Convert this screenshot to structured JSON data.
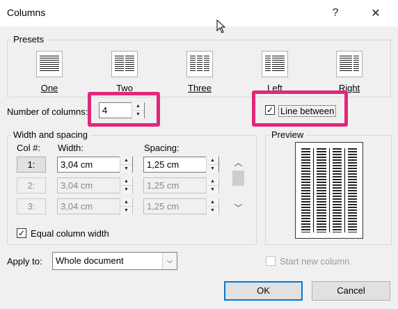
{
  "dialog": {
    "title": "Columns",
    "help_glyph": "?",
    "close_glyph": "✕"
  },
  "presets": {
    "label": "Presets",
    "items": [
      {
        "label": "One",
        "columns": 1
      },
      {
        "label": "Two",
        "columns": 2
      },
      {
        "label": "Three",
        "columns": 3
      },
      {
        "label": "Left",
        "columns": 2
      },
      {
        "label": "Right",
        "columns": 2
      }
    ]
  },
  "number_of_columns": {
    "label": "Number of columns:",
    "value": "4"
  },
  "line_between": {
    "label": "Line between",
    "checked": true
  },
  "width_spacing": {
    "label": "Width and spacing",
    "col_header": "Col #:",
    "width_header": "Width:",
    "spacing_header": "Spacing:",
    "rows": [
      {
        "col": "1:",
        "width": "3,04 cm",
        "spacing": "1,25 cm",
        "enabled": true
      },
      {
        "col": "2:",
        "width": "3,04 cm",
        "spacing": "1,25 cm",
        "enabled": false
      },
      {
        "col": "3:",
        "width": "3,04 cm",
        "spacing": "1,25 cm",
        "enabled": false
      }
    ],
    "equal_width": {
      "label": "Equal column width",
      "checked": true
    }
  },
  "preview": {
    "label": "Preview",
    "columns": 4
  },
  "apply_to": {
    "label": "Apply to:",
    "value": "Whole document"
  },
  "start_new_column": {
    "label": "Start new column",
    "checked": false,
    "enabled": false
  },
  "buttons": {
    "ok": "OK",
    "cancel": "Cancel"
  },
  "colors": {
    "highlight": "#e0287a",
    "default_button_border": "#0078d7",
    "dialog_bg": "#f0f0f0"
  }
}
